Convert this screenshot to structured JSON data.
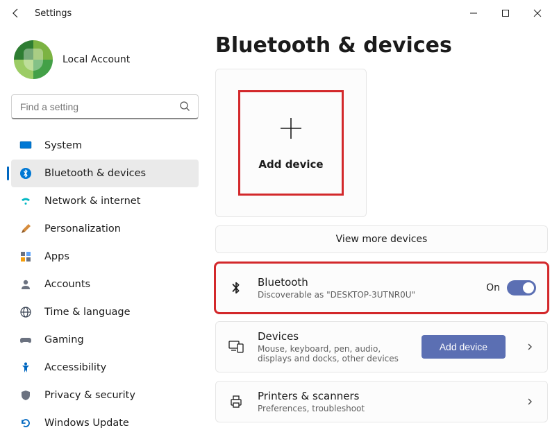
{
  "titlebar": {
    "title": "Settings"
  },
  "profile": {
    "name": "Local Account"
  },
  "search": {
    "placeholder": "Find a setting"
  },
  "sidebar": {
    "items": [
      {
        "label": "System",
        "icon": "display"
      },
      {
        "label": "Bluetooth & devices",
        "icon": "bluetooth"
      },
      {
        "label": "Network & internet",
        "icon": "wifi"
      },
      {
        "label": "Personalization",
        "icon": "brush"
      },
      {
        "label": "Apps",
        "icon": "apps"
      },
      {
        "label": "Accounts",
        "icon": "person"
      },
      {
        "label": "Time & language",
        "icon": "globe"
      },
      {
        "label": "Gaming",
        "icon": "gaming"
      },
      {
        "label": "Accessibility",
        "icon": "accessibility"
      },
      {
        "label": "Privacy & security",
        "icon": "shield"
      },
      {
        "label": "Windows Update",
        "icon": "update"
      }
    ],
    "selected_index": 1
  },
  "page": {
    "title": "Bluetooth & devices",
    "add_tile": {
      "label": "Add device"
    },
    "view_more": "View more devices",
    "bluetooth_row": {
      "title": "Bluetooth",
      "subtitle": "Discoverable as \"DESKTOP-3UTNR0U\"",
      "state_label": "On"
    },
    "devices_row": {
      "title": "Devices",
      "subtitle": "Mouse, keyboard, pen, audio, displays and docks, other devices",
      "button": "Add device"
    },
    "printers_row": {
      "title": "Printers & scanners",
      "subtitle": "Preferences, troubleshoot"
    }
  }
}
